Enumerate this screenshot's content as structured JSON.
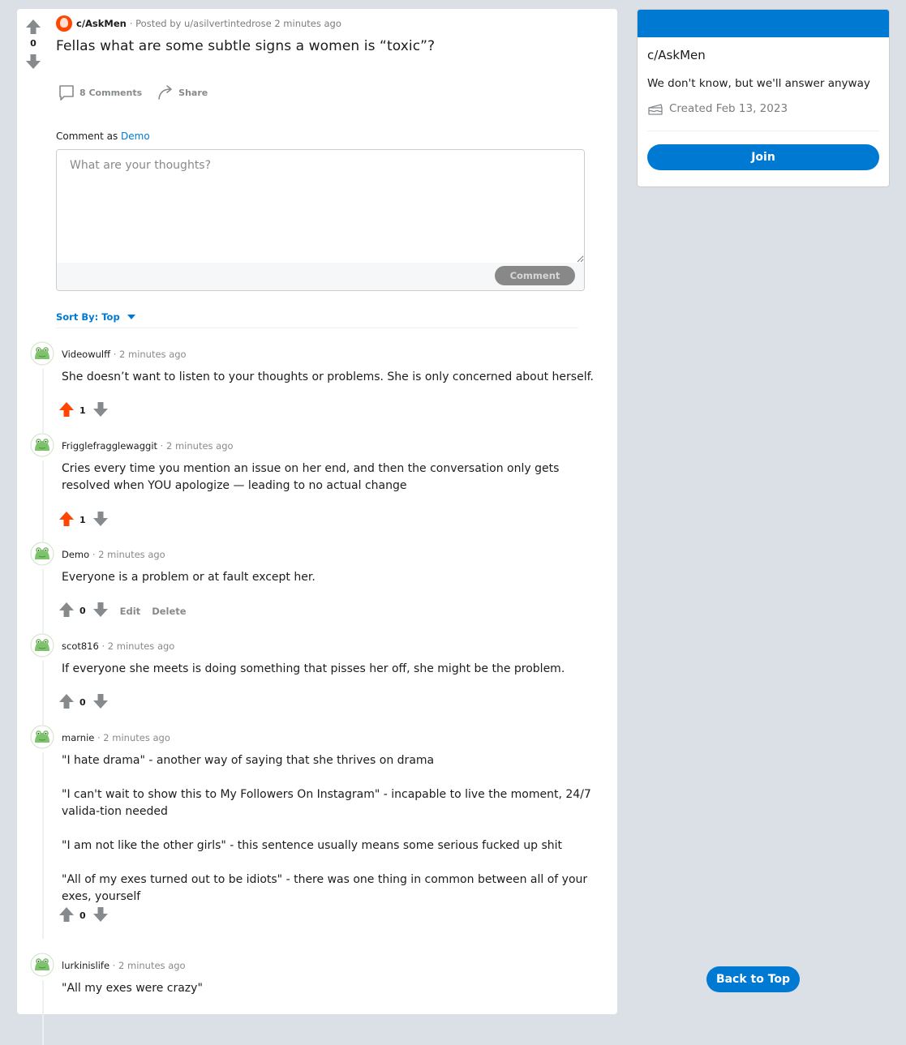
{
  "post": {
    "score": "0",
    "subreddit": "c/AskMen",
    "posted_by": "· Posted by u/asilvertintedrose 2 minutes ago",
    "title": "Fellas what are some subtle signs a women is “toxic”?",
    "comments_label": "8 Comments",
    "share_label": "Share"
  },
  "composer": {
    "comment_as": "Comment as",
    "user": "Demo",
    "placeholder": "What are your thoughts?",
    "submit_label": "Comment"
  },
  "sort": {
    "label": "Sort By: Top"
  },
  "comments": [
    {
      "author": "Videowulff",
      "time": "· 2 minutes ago",
      "paragraphs": [
        "She doesn’t want to listen to your thoughts or problems. She is only concerned about herself."
      ],
      "score": "1",
      "upvoted": true
    },
    {
      "author": "Frigglefragglewaggit",
      "time": "· 2 minutes ago",
      "paragraphs": [
        "Cries every time you mention an issue on her end, and then the conversation only gets resolved when YOU apologize — leading to no actual change"
      ],
      "score": "1",
      "upvoted": true
    },
    {
      "author": "Demo",
      "time": "· 2 minutes ago",
      "paragraphs": [
        "Everyone is a problem or at fault except her."
      ],
      "score": "0",
      "upvoted": false,
      "edit_label": "Edit",
      "delete_label": "Delete"
    },
    {
      "author": "scot816",
      "time": "· 2 minutes ago",
      "paragraphs": [
        "If everyone she meets is doing something that pisses her off, she might be the problem."
      ],
      "score": "0",
      "upvoted": false
    },
    {
      "author": "marnie",
      "time": "· 2 minutes ago",
      "paragraphs": [
        "\"I hate drama\" - another way of saying that she thrives on drama",
        "\"I can't wait to show this to My Followers On Instagram\" - incapable to live the moment, 24/7 valida-tion needed",
        "\"I am not like the other girls\" - this sentence usually means some serious fucked up shit",
        "\"All of my exes turned out to be idiots\" - there was one thing in common between all of your exes, yourself"
      ],
      "score": "0",
      "upvoted": false
    },
    {
      "author": "lurkinislife",
      "time": "· 2 minutes ago",
      "paragraphs": [
        "\"All my exes were crazy\""
      ],
      "score": "",
      "upvoted": false
    }
  ],
  "sidebar": {
    "title": "c/AskMen",
    "description": "We don't know, but we'll answer anyway",
    "created": "Created Feb 13, 2023",
    "join_label": "Join"
  },
  "back_to_top": "Back to Top",
  "colors": {
    "accent": "#0079d3",
    "upvote": "#ff4500",
    "page_bg": "#dae0e6"
  }
}
